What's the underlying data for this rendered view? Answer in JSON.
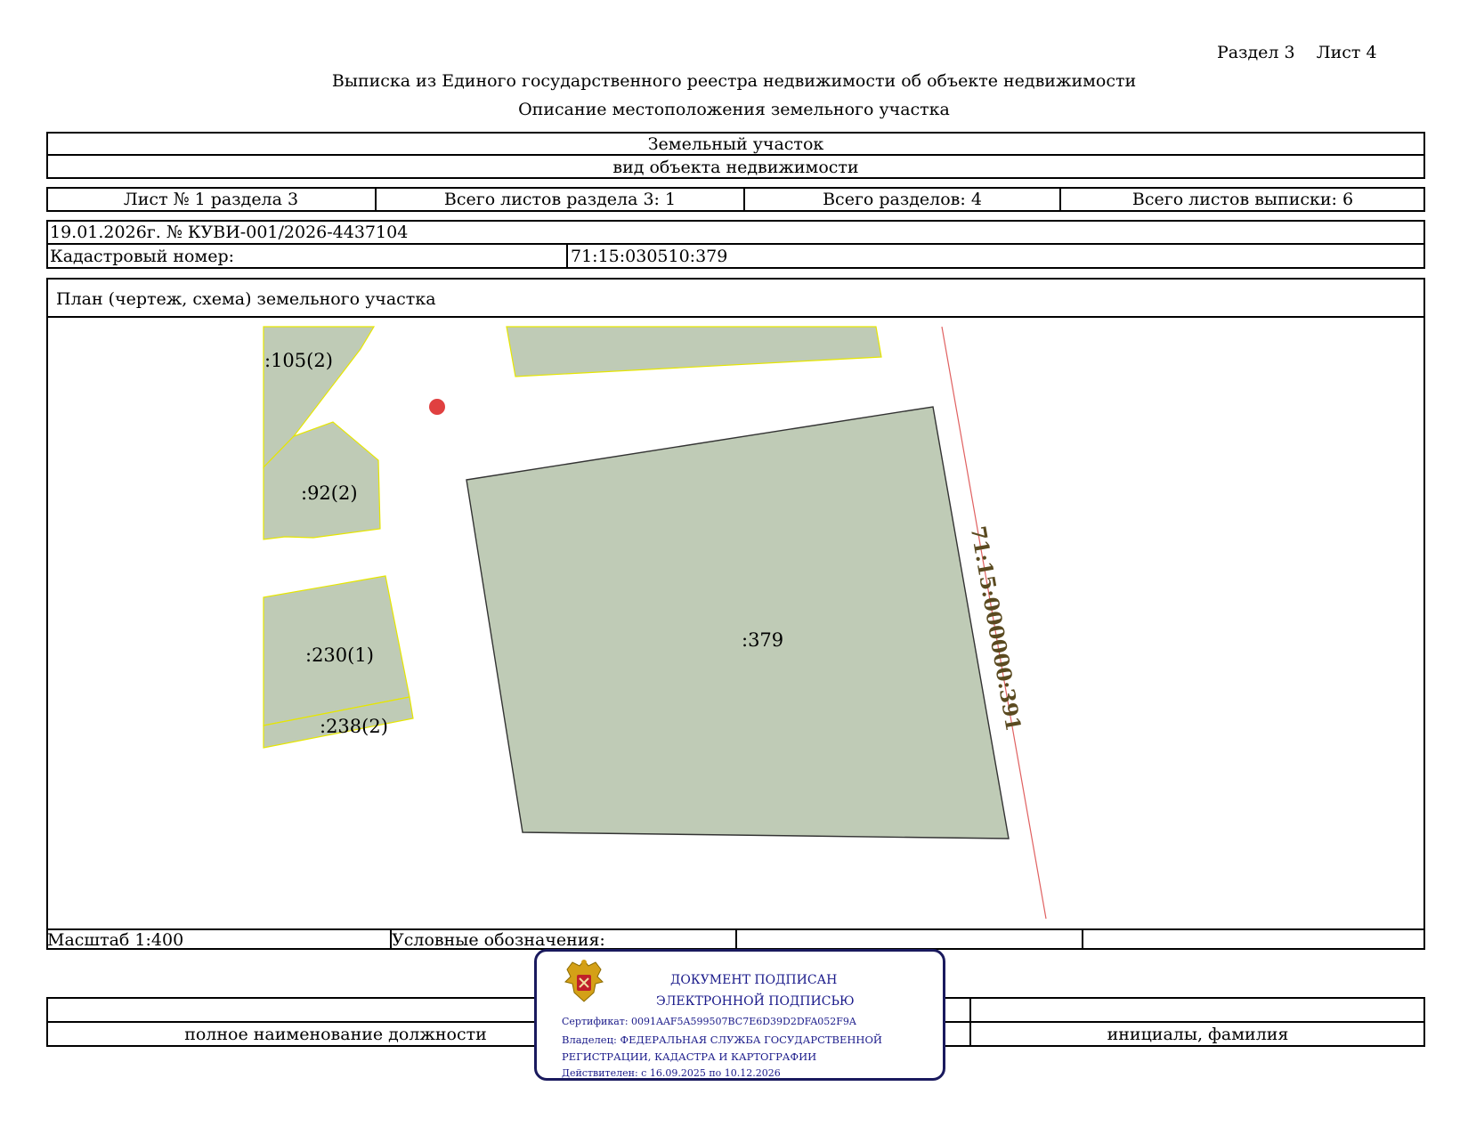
{
  "header": {
    "section_sheet": "Раздел 3    Лист 4",
    "title": "Выписка из Единого государственного реестра недвижимости об объекте недвижимости",
    "subtitle": "Описание местоположения земельного участка"
  },
  "object": {
    "name": "Земельный участок",
    "kind_caption": "вид объекта недвижимости"
  },
  "sheets": {
    "sheet_no": "Лист № 1 раздела 3",
    "section_sheets_total": "Всего листов раздела 3: 1",
    "sections_total": "Всего разделов: 4",
    "extract_sheets_total": "Всего листов выписки: 6"
  },
  "record": {
    "date_number": "19.01.2026г. № КУВИ-001/2026-4437104",
    "cadastral_label": "Кадастровый номер:",
    "cadastral_value": "71:15:030510:379"
  },
  "plan": {
    "title": "План (чертеж, схема) земельного участка",
    "parcel_labels": {
      "p105": ":105(2)",
      "p92": ":92(2)",
      "p230": ":230(1)",
      "p238": ":238(2)",
      "p379": ":379"
    },
    "boundary_label": "71:15:000000:391",
    "colors": {
      "parcel_fill": "#bfcbb6",
      "neighbor_border": "#e6e600",
      "main_border": "#333333",
      "boundary_line": "#e06060",
      "boundary_text": "#5a4a20",
      "marker": "#e04040"
    }
  },
  "footer": {
    "scale": "Масштаб 1:400",
    "legend_label": "Условные обозначения:",
    "position_caption": "полное наименование должности",
    "initials_caption": "инициалы, фамилия"
  },
  "stamp": {
    "line1": "ДОКУМЕНТ ПОДПИСАН",
    "line2": "ЭЛЕКТРОННОЙ ПОДПИСЬЮ",
    "certificate": "Сертификат: 0091AAF5A599507BC7E6D39D2DFA052F9A",
    "owner1": "Владелец: ФЕДЕРАЛЬНАЯ СЛУЖБА ГОСУДАРСТВЕННОЙ",
    "owner2": "РЕГИСТРАЦИИ, КАДАСТРА И КАРТОГРАФИИ",
    "valid": "Действителен: с 16.09.2025 по 10.12.2026"
  }
}
